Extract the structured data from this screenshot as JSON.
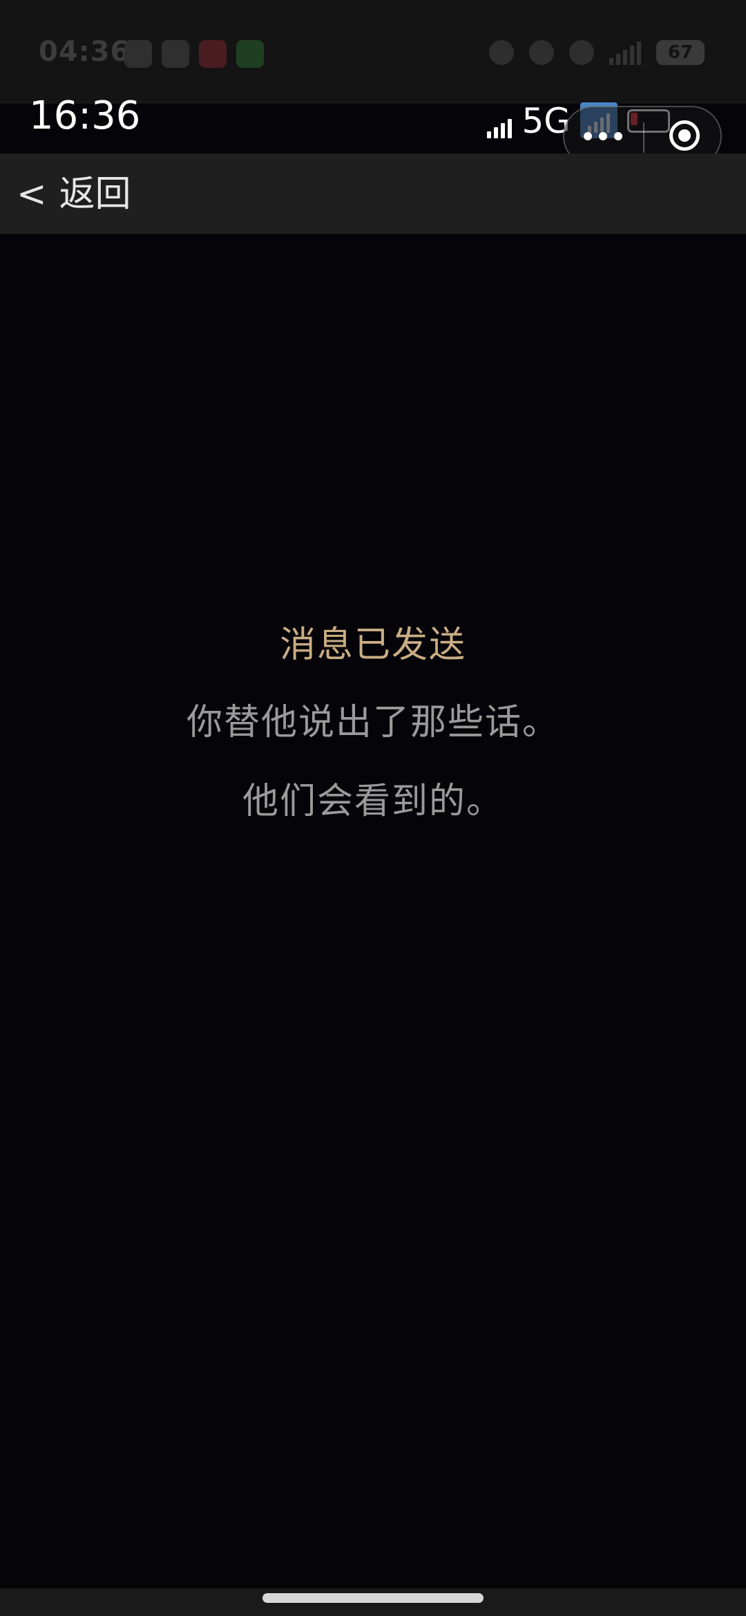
{
  "ghost_status": {
    "time": "04:36",
    "battery": "67"
  },
  "status_bar": {
    "time": "16:36",
    "network": "5G"
  },
  "capsule": {
    "more_icon": "more-dots-icon",
    "close_icon": "capsule-close-icon"
  },
  "nav": {
    "back_chevron": "<",
    "back_label": "返回"
  },
  "message": {
    "title": "消息已发送",
    "line1": "你替他说出了那些话。",
    "line2": "他们会看到的。"
  },
  "colors": {
    "title_accent": "#c9ad84",
    "body_text": "#9a9a9a",
    "background": "#050408",
    "nav_background": "#1f1f1f"
  }
}
